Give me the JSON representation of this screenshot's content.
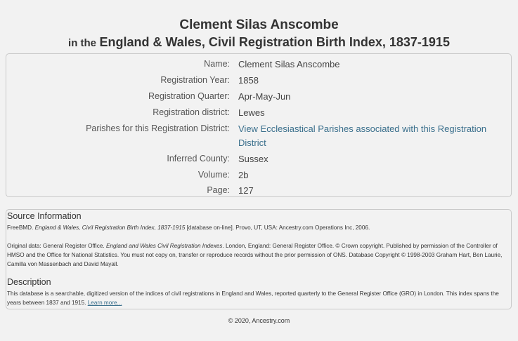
{
  "header": {
    "name": "Clement Silas Anscombe",
    "in_the": "in the",
    "collection": "England & Wales, Civil Registration Birth Index, 1837-1915"
  },
  "details": [
    {
      "label": "Name:",
      "value": "Clement Silas Anscombe"
    },
    {
      "label": "Registration Year:",
      "value": "1858"
    },
    {
      "label": "Registration Quarter:",
      "value": "Apr-May-Jun"
    },
    {
      "label": "Registration district:",
      "value": "Lewes"
    },
    {
      "label": "Parishes for this Registration District:",
      "value": "View Ecclesiastical Parishes associated with this Registration District"
    },
    {
      "label": "Inferred County:",
      "value": "Sussex"
    },
    {
      "label": "Volume:",
      "value": "2b"
    },
    {
      "label": "Page:",
      "value": "127"
    }
  ],
  "source": {
    "heading": "Source Information",
    "citation_pre": "FreeBMD. ",
    "citation_title": "England & Wales, Civil Registration Birth Index, 1837-1915",
    "citation_post": " [database on-line]. Provo, UT, USA: Ancestry.com Operations Inc, 2006.",
    "original_pre": "Original data: General Register Office. ",
    "original_title": "England and Wales Civil Registration Indexes",
    "original_post": ". London, England: General Register Office. © Crown copyright. Published by permission of the Controller of HMSO and the Office for National Statistics. You must not copy on, transfer or reproduce records without the prior permission of ONS. Database Copyright © 1998-2003 Graham Hart, Ben Laurie, Camilla von Massenbach and David Mayall."
  },
  "description": {
    "heading": "Description",
    "text": "This database is a searchable, digitized version of the indices of civil registrations in England and Wales, reported quarterly to the General Register Office (GRO) in London. This index spans the years between 1837 and 1915. ",
    "learn_more": "Learn more..."
  },
  "footer": {
    "copyright": "© 2020, Ancestry.com"
  }
}
